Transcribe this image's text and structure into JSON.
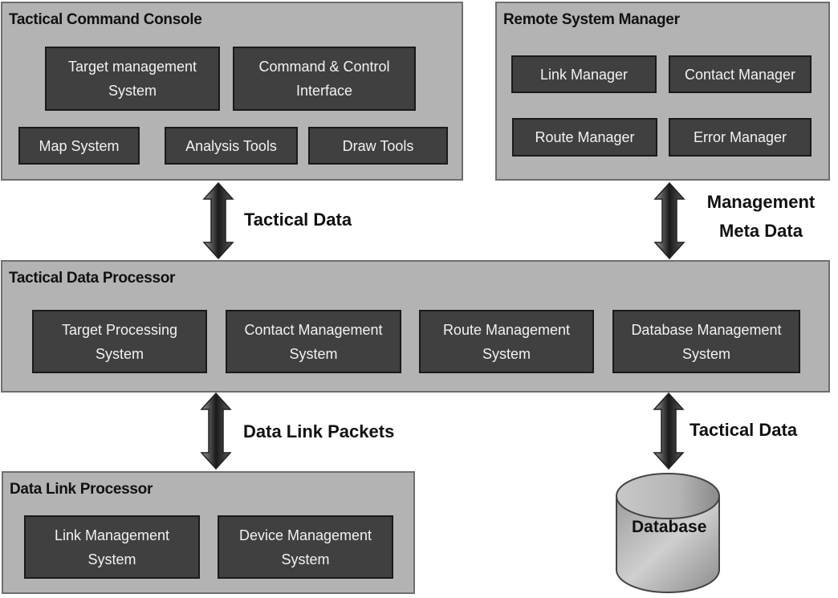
{
  "panels": {
    "tcc": {
      "title": "Tactical Command Console",
      "modules": [
        {
          "line1": "Target management",
          "line2": "System"
        },
        {
          "line1": "Command & Control",
          "line2": "Interface"
        },
        {
          "line1": "Map System",
          "line2": ""
        },
        {
          "line1": "Analysis Tools",
          "line2": ""
        },
        {
          "line1": "Draw Tools",
          "line2": ""
        }
      ]
    },
    "rsm": {
      "title": "Remote System Manager",
      "modules": [
        {
          "line1": "Link Manager"
        },
        {
          "line1": "Contact Manager"
        },
        {
          "line1": "Route Manager"
        },
        {
          "line1": "Error Manager"
        }
      ]
    },
    "tdp": {
      "title": "Tactical Data Processor",
      "modules": [
        {
          "line1": "Target Processing",
          "line2": "System"
        },
        {
          "line1": "Contact Management",
          "line2": "System"
        },
        {
          "line1": "Route Management",
          "line2": "System"
        },
        {
          "line1": "Database Management",
          "line2": "System"
        }
      ]
    },
    "dlp": {
      "title": "Data Link Processor",
      "modules": [
        {
          "line1": "Link Management",
          "line2": "System"
        },
        {
          "line1": "Device Management",
          "line2": "System"
        }
      ]
    }
  },
  "flows": {
    "tcc_tdp": {
      "line1": "Tactical Data"
    },
    "rsm_tdp": {
      "line1": "Management",
      "line2": "Meta Data"
    },
    "tdp_dlp": {
      "line1": "Data Link Packets"
    },
    "tdp_db": {
      "line1": "Tactical Data"
    }
  },
  "database": {
    "label": "Database"
  },
  "colors": {
    "panel_fill": "#b3b3b3",
    "panel_border": "#6e6e6e",
    "module_fill": "#404040",
    "module_text": "#f2f2f2"
  }
}
